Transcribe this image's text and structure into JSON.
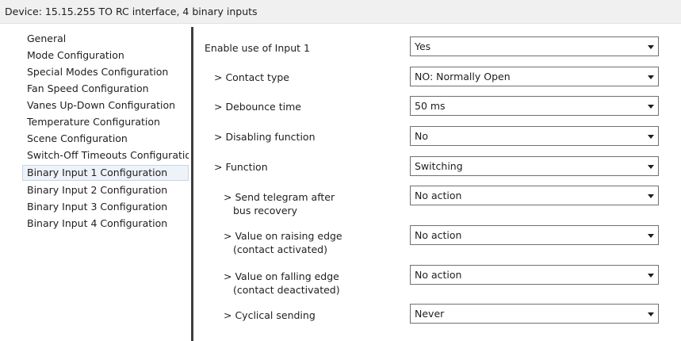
{
  "title_bar": {
    "text": "Device: 15.15.255  TO RC interface, 4 binary inputs"
  },
  "sidebar": {
    "items": [
      {
        "label": "General"
      },
      {
        "label": "Mode Configuration"
      },
      {
        "label": "Special Modes Configuration"
      },
      {
        "label": "Fan Speed Configuration"
      },
      {
        "label": "Vanes Up-Down Configuration"
      },
      {
        "label": "Temperature Configuration"
      },
      {
        "label": "Scene Configuration"
      },
      {
        "label": "Switch-Off Timeouts Configuration"
      },
      {
        "label": "Binary Input 1 Configuration",
        "selected": true
      },
      {
        "label": "Binary Input 2 Configuration"
      },
      {
        "label": "Binary Input 3 Configuration"
      },
      {
        "label": "Binary Input 4 Configuration"
      }
    ]
  },
  "parameters": [
    {
      "label": "Enable use of Input 1",
      "value": "Yes"
    },
    {
      "label": "> Contact type",
      "value": "NO: Normally Open"
    },
    {
      "label": "> Debounce time",
      "value": "50 ms"
    },
    {
      "label": "> Disabling function",
      "value": "No"
    },
    {
      "label": "> Function",
      "value": "Switching"
    },
    {
      "label_line1": "> Send telegram after",
      "label_line2": "bus recovery",
      "value": "No action"
    },
    {
      "label_line1": "> Value on raising edge",
      "label_line2": "(contact activated)",
      "value": "No action"
    },
    {
      "label_line1": "> Value on falling edge",
      "label_line2": "(contact deactivated)",
      "value": "No action"
    },
    {
      "label": "> Cyclical sending",
      "value": "Never"
    }
  ],
  "icons": {
    "dropdown_arrow": "chevron-down-icon"
  }
}
